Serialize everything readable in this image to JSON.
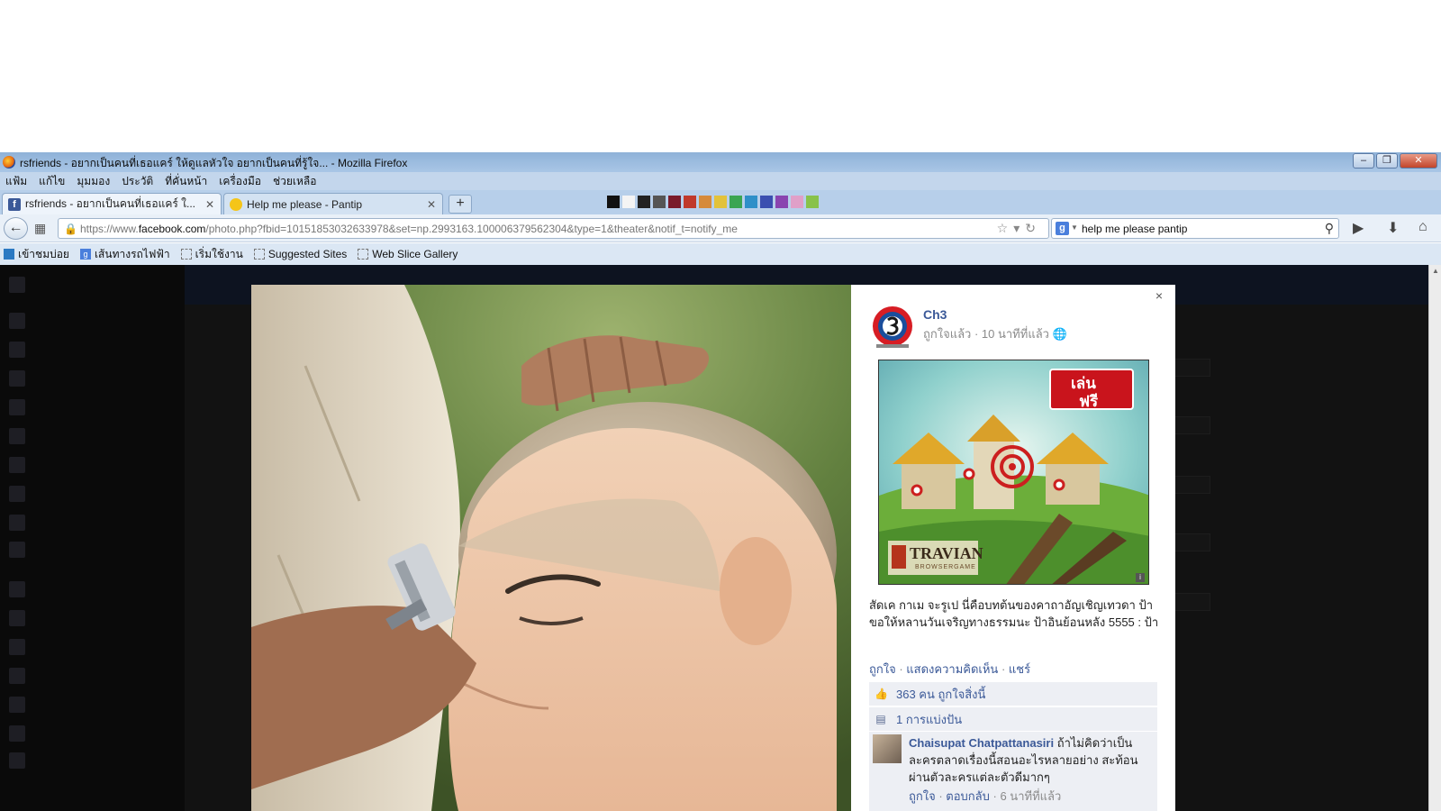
{
  "window": {
    "title": "rsfriends - อยากเป็นคนที่เธอแคร์ ให้ดูแลหัวใจ อยากเป็นคนที่รู้ใจ... - Mozilla Firefox",
    "buttons": {
      "minimize": "–",
      "maximize": "❐",
      "close": "✕"
    }
  },
  "menu": [
    "แฟ้ม",
    "แก้ไข",
    "มุมมอง",
    "ประวัติ",
    "ที่คั่นหน้า",
    "เครื่องมือ",
    "ช่วยเหลือ"
  ],
  "tabs": [
    {
      "label": "rsfriends - อยากเป็นคนที่เธอแคร์ ใ...",
      "favicon": "f",
      "close": "✕"
    },
    {
      "label": "Help me please - Pantip",
      "close": "✕"
    }
  ],
  "new_tab": "+",
  "nav": {
    "url_prefix": "https://www.",
    "url_domain": "facebook.com",
    "url_rest": "/photo.php?fbid=10151853032633978&set=np.2993163.100006379562304&type=1&theater&notif_t=notify_me",
    "search_engine": "g",
    "search_query": "help me please pantip"
  },
  "bookmarks": [
    "เข้าชมบ่อย",
    "เส้นทางรถไฟฟ้า",
    "เริ่มใช้งาน",
    "Suggested Sites",
    "Web Slice Gallery"
  ],
  "post": {
    "close": "×",
    "page_name": "Ch3",
    "liked_label": "ถูกใจแล้ว",
    "time": "10 นาทีที่แล้ว",
    "ad_badge_line1": "เล่น",
    "ad_badge_line2": "ฟรี",
    "ad_brand": "TRAVIAN",
    "ad_brand_sub": "BROWSERGAME",
    "caption": "สัดเค กาเม จะรูเป นี่คือบทต้นของคาถาอัญเชิญเทวดา ป้า ขอให้หลานวันเจริญทางธรรมนะ ป้าอินย้อนหลัง 5555 : ป้า",
    "actions": {
      "like": "ถูกใจ",
      "comment": "แสดงความคิดเห็น",
      "share": "แชร์"
    },
    "likes_count": "363 คน",
    "likes_suffix": "ถูกใจสิ่งนี้",
    "shares_text": "1 การแบ่งปัน",
    "comment": {
      "author": "Chaisupat Chatpattanasiri",
      "text": "ถ้าไม่คิดว่าเป็นละครตลาดเรื่องนี้สอนอะไรหลายอย่าง สะท้อนผ่านตัวละครแต่ละตัวดีมากๆ",
      "like": "ถูกใจ",
      "reply": "ตอบกลับ",
      "time": "6 นาทีที่แล้ว"
    }
  },
  "colors": {
    "fb_blue": "#3b5998",
    "fb_panel": "#edeff4",
    "window_chrome": "#a9c6e6"
  }
}
